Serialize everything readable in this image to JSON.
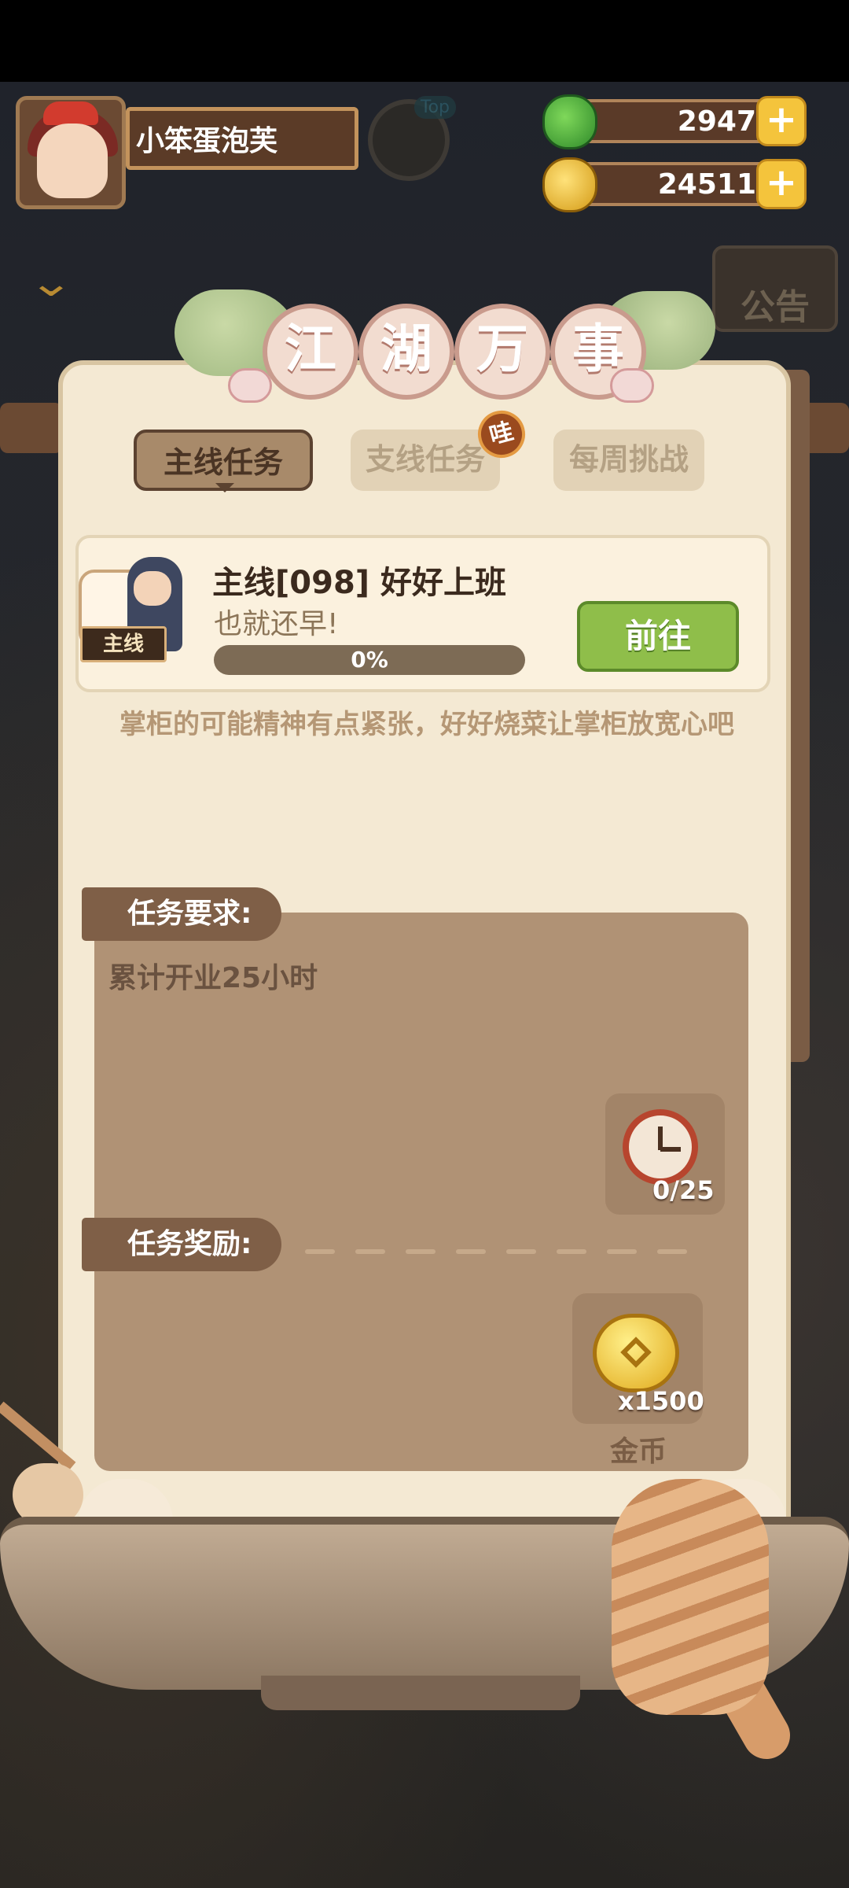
{
  "player": {
    "name": "小笨蛋泡芙",
    "top_badge": "Top"
  },
  "currency": {
    "jade": {
      "value": "2947",
      "plus": "+"
    },
    "coin": {
      "value": "24511",
      "plus": "+"
    }
  },
  "notice": {
    "label": "公告"
  },
  "panel": {
    "title_chars": [
      "江",
      "湖",
      "万",
      "事"
    ],
    "tabs": {
      "main": "主线任务",
      "side": "支线任务",
      "weekly": "每周挑战",
      "side_badge": "哇"
    }
  },
  "quest": {
    "tag": "主线",
    "title": "主线[098] 好好上班",
    "subtitle": "也就还早!",
    "progress_text": "0%",
    "progress_value": 0,
    "go_button": "前往",
    "description": "掌柜的可能精神有点紧张，好好烧菜让掌柜放宽心吧"
  },
  "requirement": {
    "label": "任务要求:",
    "text": "累计开业25小时",
    "count": "0/25"
  },
  "reward": {
    "label": "任务奖励:",
    "item_qty": "x1500",
    "item_name": "金币"
  },
  "colors": {
    "accent_green": "#8fbe4a",
    "panel_bg": "#f4e9d3",
    "label_brown": "#7f5f47"
  }
}
